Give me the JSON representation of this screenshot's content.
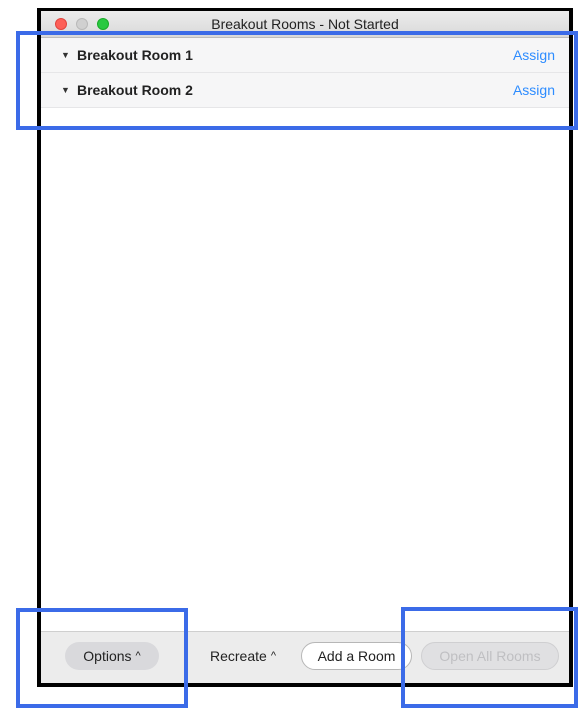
{
  "window": {
    "title": "Breakout Rooms - Not Started"
  },
  "rooms": [
    {
      "name": "Breakout Room 1",
      "action": "Assign"
    },
    {
      "name": "Breakout Room 2",
      "action": "Assign"
    }
  ],
  "footer": {
    "options_label": "Options",
    "recreate_label": "Recreate",
    "add_room_label": "Add a Room",
    "open_all_label": "Open All Rooms",
    "chevron": "^"
  },
  "colors": {
    "accent": "#2d8cff",
    "highlight_box": "#3b6be8"
  }
}
